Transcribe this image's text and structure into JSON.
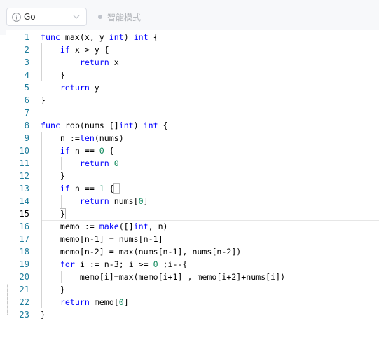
{
  "toolbar": {
    "language": "Go",
    "language_icon": "info-circle-icon",
    "dropdown_icon": "chevron-down-icon",
    "mode_label": "智能模式"
  },
  "editor": {
    "active_line": 15,
    "lines": [
      {
        "n": "1"
      },
      {
        "n": "2"
      },
      {
        "n": "3"
      },
      {
        "n": "4"
      },
      {
        "n": "5"
      },
      {
        "n": "6"
      },
      {
        "n": "7"
      },
      {
        "n": "8"
      },
      {
        "n": "9"
      },
      {
        "n": "10"
      },
      {
        "n": "11"
      },
      {
        "n": "12"
      },
      {
        "n": "13"
      },
      {
        "n": "14"
      },
      {
        "n": "15"
      },
      {
        "n": "16"
      },
      {
        "n": "17"
      },
      {
        "n": "18"
      },
      {
        "n": "19"
      },
      {
        "n": "20"
      },
      {
        "n": "21"
      },
      {
        "n": "22"
      },
      {
        "n": "23"
      }
    ],
    "code": [
      "func max(x, y int) int {",
      "    if x > y {",
      "        return x",
      "    }",
      "    return y",
      "}",
      "",
      "func rob(nums []int) int {",
      "    n :=len(nums)",
      "    if n == 0 {",
      "        return 0",
      "    }",
      "    if n == 1 {",
      "        return nums[0]",
      "    }",
      "    memo := make([]int, n)",
      "    memo[n-1] = nums[n-1]",
      "    memo[n-2] = max(nums[n-1], nums[n-2])",
      "    for i := n-3; i >= 0 ;i--{",
      "        memo[i]=max(memo[i+1] , memo[i+2]+nums[i])",
      "    }",
      "    return memo[0]",
      "}"
    ]
  }
}
